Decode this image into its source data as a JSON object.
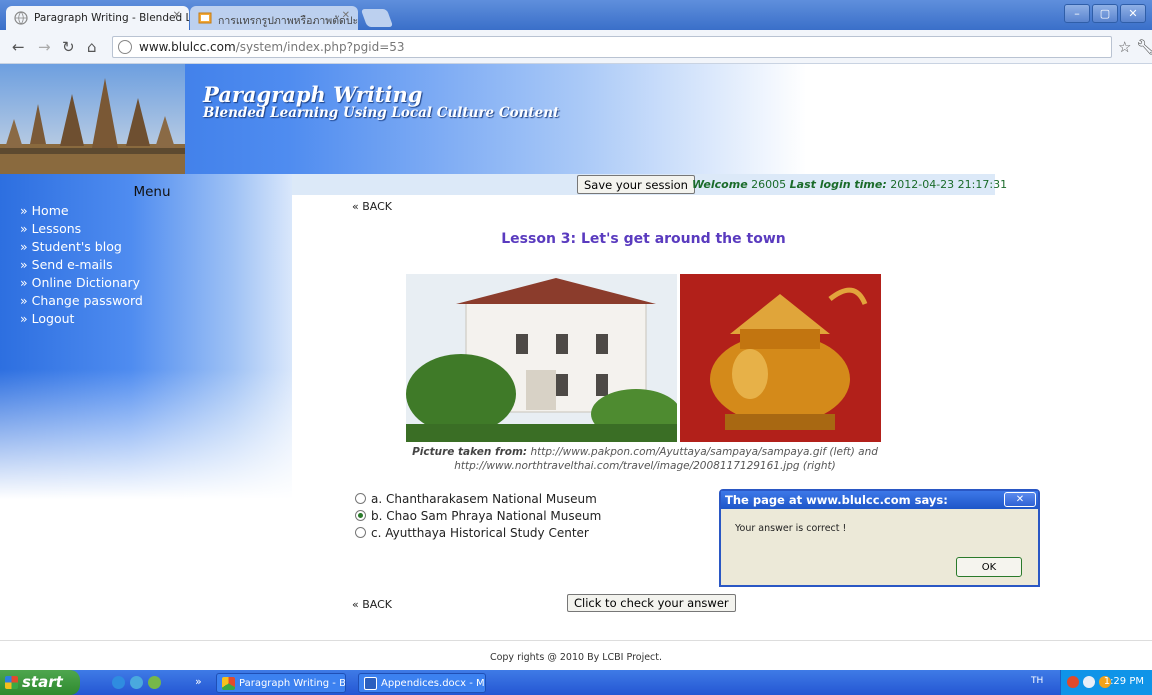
{
  "browser": {
    "tabs": [
      {
        "title": "Paragraph Writing - Blended Lᵢ",
        "active": true
      },
      {
        "title": "การแทรกรูปภาพหรือภาพตัดปะ -",
        "active": false
      }
    ],
    "url_host": "www.blulcc.com",
    "url_path": "/system/index.php?pgid=53"
  },
  "site": {
    "title": "Paragraph Writing",
    "subtitle": "Blended Learning Using Local Culture Content"
  },
  "sidebar": {
    "menu_title": "Menu",
    "items": [
      {
        "label": "Home"
      },
      {
        "label": "Lessons"
      },
      {
        "label": "Student's blog"
      },
      {
        "label": "Send e-mails"
      },
      {
        "label": "Online Dictionary"
      },
      {
        "label": "Change password"
      },
      {
        "label": "Logout"
      }
    ]
  },
  "session": {
    "save_label": "Save your session",
    "welcome_label": "Welcome",
    "user_id": "26005",
    "last_login_label": "Last login time:",
    "last_login_value": "2012-04-23 21:17:31"
  },
  "lesson": {
    "back_label": "« BACK",
    "title": "Lesson 3: Let's get around the town",
    "caption_label": "Picture taken from:",
    "caption_line1": "http://www.pakpon.com/Ayuttaya/sampaya/sampaya.gif (left) and",
    "caption_line2": "http://www.northtravelthai.com/travel/image/2008117129161.jpg (right)",
    "options": [
      {
        "label": "a. Chantharakasem National Museum",
        "checked": false
      },
      {
        "label": "b. Chao Sam Phraya National Museum",
        "checked": true
      },
      {
        "label": "c. Ayutthaya Historical Study Center",
        "checked": false
      }
    ],
    "check_label": "Click to check your answer"
  },
  "footer": {
    "text": "Copy rights @ 2010 By LCBI Project."
  },
  "dialog": {
    "title": "The page at www.blulcc.com says:",
    "message": "Your answer is correct !",
    "ok_label": "OK"
  },
  "taskbar": {
    "start_label": "start",
    "tasks": [
      {
        "label": "Paragraph Writing - B..."
      },
      {
        "label": "Appendices.docx - Mi..."
      }
    ],
    "lang": "TH",
    "clock": "1:29 PM"
  },
  "colors": {
    "header_blue": "#2d6fe0",
    "lesson_title": "#5a3bbf",
    "welcome_green": "#1a6b2a",
    "dialog_title": "#1e56c8"
  }
}
